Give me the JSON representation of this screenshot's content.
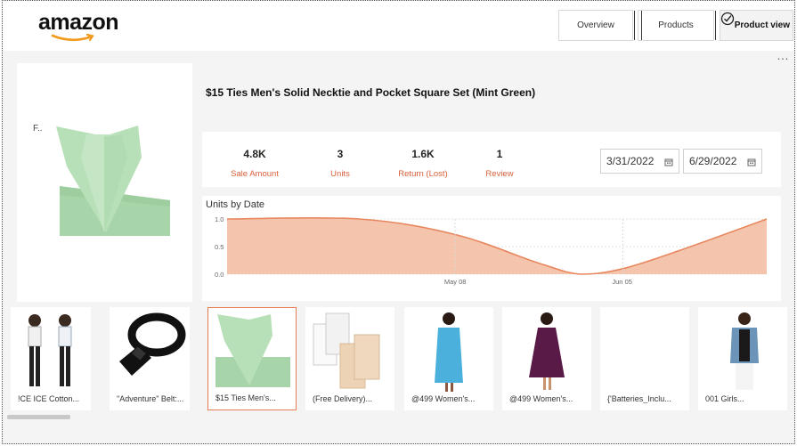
{
  "logo": {
    "text": "amazon"
  },
  "nav": {
    "overview": "Overview",
    "products": "Products",
    "product_view": "Product view"
  },
  "product": {
    "image_label": "F..",
    "title": "$15 Ties Men's Solid Necktie and Pocket Square Set (Mint Green)"
  },
  "kpis": [
    {
      "value": "4.8K",
      "label": "Sale Amount"
    },
    {
      "value": "3",
      "label": "Units"
    },
    {
      "value": "1.6K",
      "label": "Return (Lost)"
    },
    {
      "value": "1",
      "label": "Review"
    }
  ],
  "date_range": {
    "start": "3/31/2022",
    "end": "6/29/2022"
  },
  "chart_data": {
    "type": "area",
    "title": "Units by Date",
    "y_ticks": [
      "1.0",
      "0.5",
      "0.0"
    ],
    "x_ticks": [
      "May 08",
      "Jun 05"
    ],
    "ylim": [
      0,
      1
    ],
    "series": [
      {
        "values_xy": [
          [
            "2022-03-31",
            1.0
          ],
          [
            "2022-04-22",
            1.0
          ],
          [
            "2022-05-08",
            0.72
          ],
          [
            "2022-05-22",
            0.2
          ],
          [
            "2022-05-29",
            0.0
          ],
          [
            "2022-06-05",
            0.1
          ],
          [
            "2022-06-15",
            0.45
          ],
          [
            "2022-06-29",
            1.0
          ]
        ]
      }
    ],
    "color": "#f4c4ad",
    "line_color": "#e8875e",
    "grid": true
  },
  "thumbnails": [
    {
      "caption": "!CE ICE Cotton..."
    },
    {
      "caption": "\"Adventure\" Belt:..."
    },
    {
      "caption": "$15 Ties Men's..."
    },
    {
      "caption": "(Free Delivery)..."
    },
    {
      "caption": "@499 Women's..."
    },
    {
      "caption": "@499 Women's..."
    },
    {
      "caption": "{'Batteries_Inclu..."
    },
    {
      "caption": "001 Girls..."
    }
  ],
  "more_icon": "…"
}
